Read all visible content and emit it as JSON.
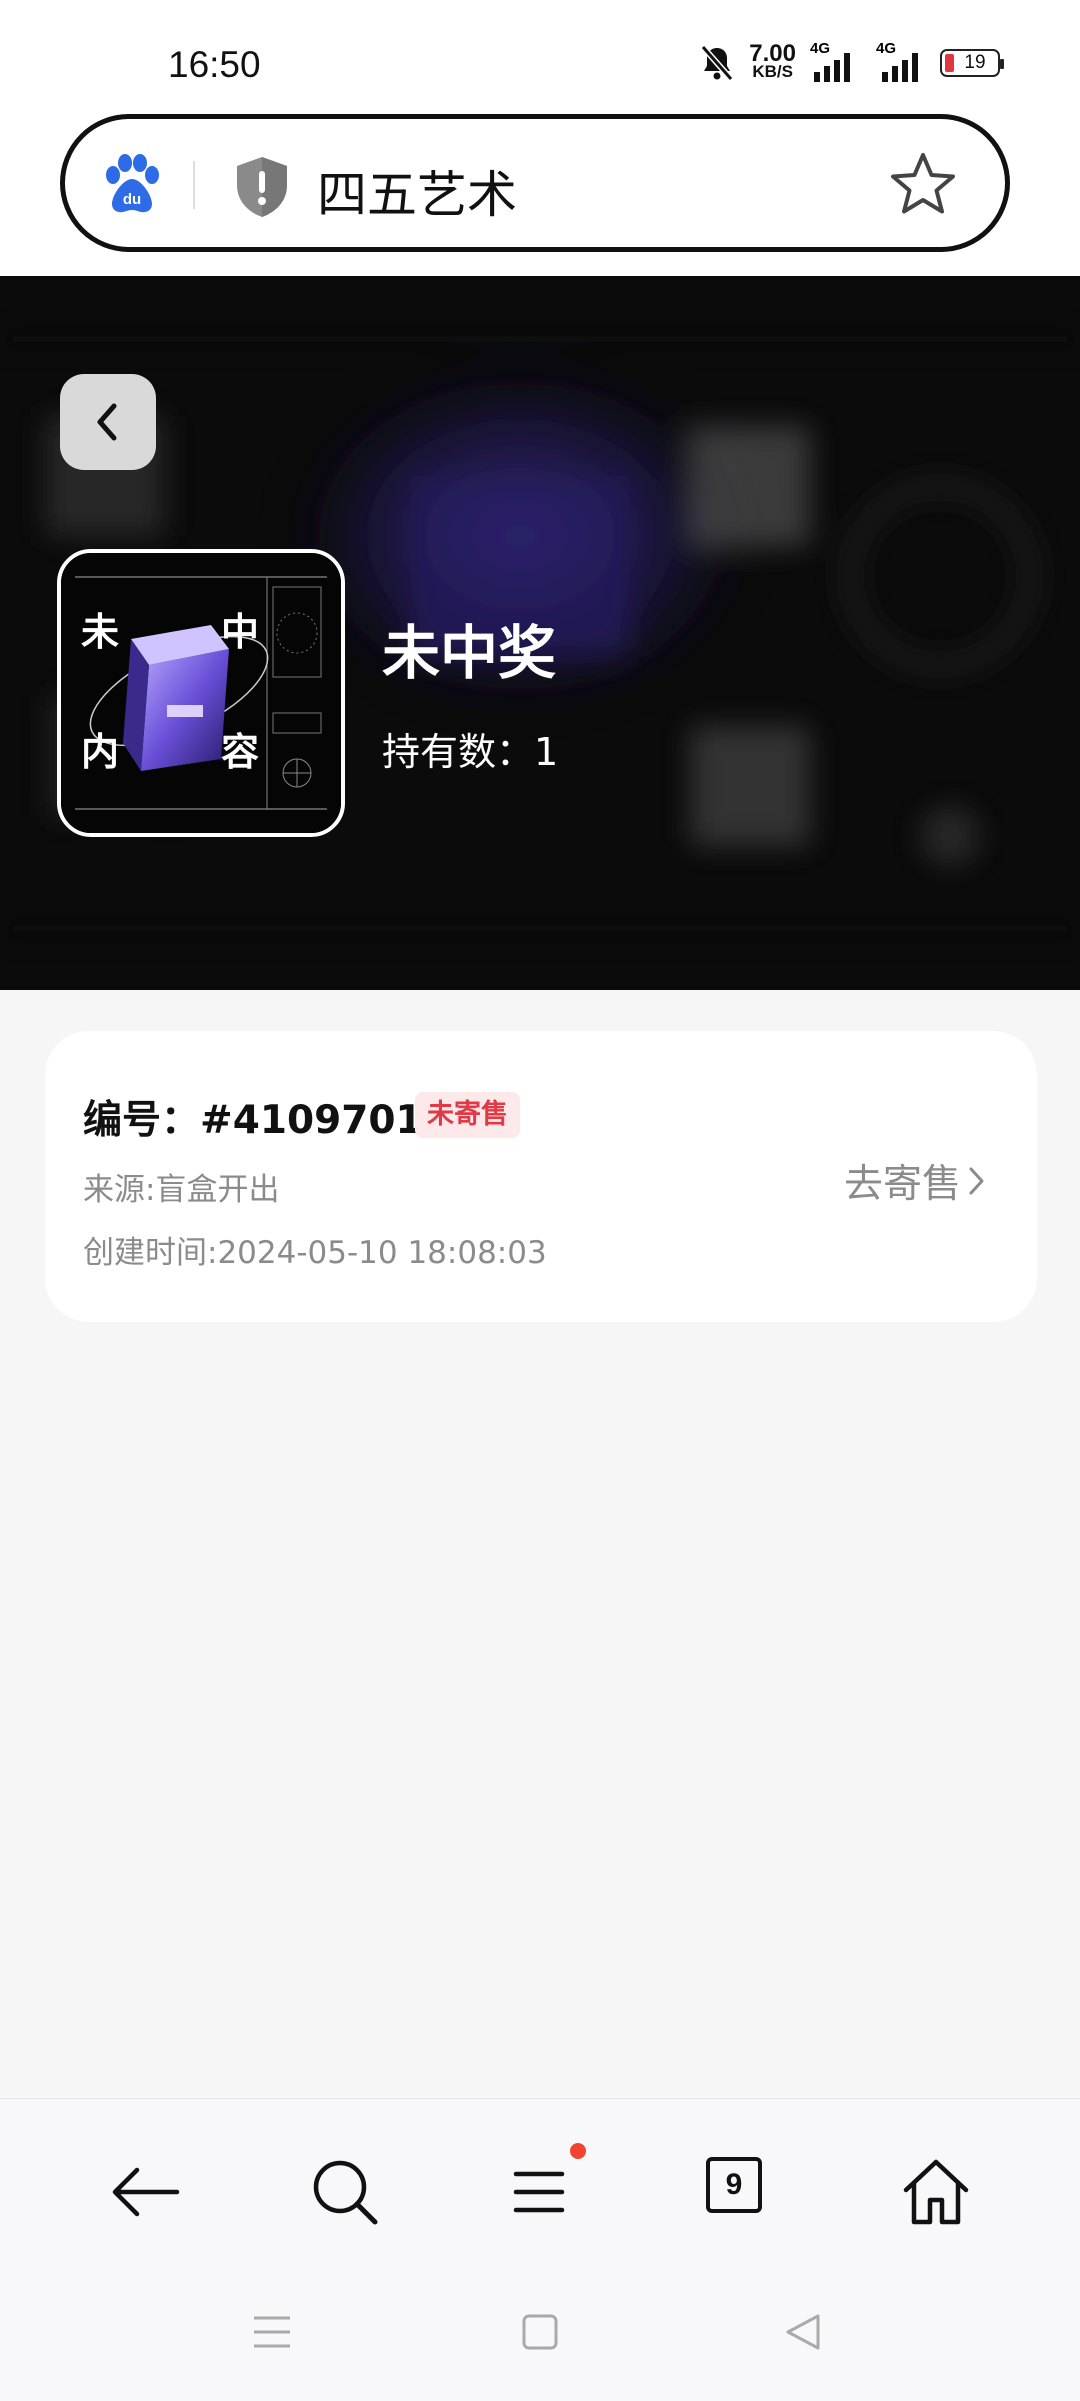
{
  "status_bar": {
    "time": "16:50",
    "speed_value": "7.00",
    "speed_unit": "KB/S",
    "signal_1": "4G",
    "signal_2": "4G",
    "battery": "19",
    "icons": [
      "bell-muted-icon",
      "signal-icon",
      "signal-icon",
      "battery-icon"
    ]
  },
  "address_bar": {
    "site_title": "四五艺术",
    "icons": [
      "baidu-paw-icon",
      "shield-warning-icon",
      "star-icon"
    ]
  },
  "hero": {
    "title": "未中奖",
    "count_label": "持有数：",
    "count_value": "1",
    "thumbnail_glyphs": [
      "未",
      "中",
      "内",
      "容"
    ]
  },
  "detail_card": {
    "serial_label": "编号：",
    "serial_value": "#4109701",
    "status_badge": "未寄售",
    "source": "来源:盲盒开出",
    "created": "创建时间:2024-05-10 18:08:03",
    "sell_link": "去寄售"
  },
  "browser_toolbar": {
    "tabs_count": "9",
    "icons": [
      "back-arrow-icon",
      "search-icon",
      "menu-icon",
      "tabs-icon",
      "home-icon"
    ]
  },
  "system_nav": {
    "icons": [
      "recents-icon",
      "home-square-icon",
      "back-triangle-icon"
    ]
  },
  "colors": {
    "badge_text": "#e13a45",
    "badge_bg": "#fde8ea",
    "notification_dot": "#f0442e",
    "baidu_blue": "#2e6be6"
  }
}
